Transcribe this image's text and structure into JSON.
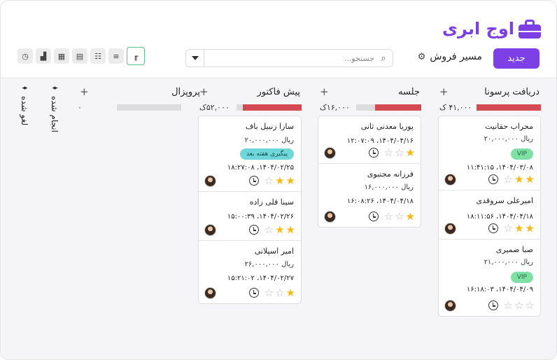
{
  "brand": {
    "logo_text": "اوج ابری",
    "accent": "#7d40e6"
  },
  "toolbar": {
    "new_button": "جدید",
    "pipeline_label": "مسیر فروش",
    "search_placeholder": "جستجو...",
    "view_icons": [
      "kanban-icon",
      "list-icon",
      "table-icon",
      "calendar-icon",
      "grid-icon",
      "chart-icon",
      "history-icon"
    ]
  },
  "columns": [
    {
      "title": "دریافت پرسونا",
      "amount": "۴۱,۰۰۰ ک",
      "progress": 0.7,
      "cards": [
        {
          "name": "محراب حقانیت",
          "amount": "ریال ۲۰,۰۰۰,۰۰۰",
          "badge": "VIP",
          "date": "۱۴۰۴/۰۳/۰۸، ۱۱:۴۱:۱۵",
          "stars": 2
        },
        {
          "name": "امیرعلی سروقدی",
          "amount": "",
          "badge": "",
          "date": "۱۴۰۴/۰۴/۱۸، ۱۸:۱۱:۵۶",
          "stars": 2
        },
        {
          "name": "صبا ضمیری",
          "amount": "ریال ۲۱,۰۰۰,۰۰۰",
          "badge": "VIP",
          "date": "۱۴۰۴/۰۴/۰۹، ۱۶:۱۸:۰۳",
          "stars": 0
        }
      ]
    },
    {
      "title": "جلسه",
      "amount": "۱۶,۰۰۰ک",
      "progress": 0.7,
      "cards": [
        {
          "name": "پوریا معدنی ثانی",
          "amount": "",
          "badge": "",
          "date": "۱۴۰۴/۰۴/۱۶، ۱۲:۰۷:۰۹",
          "stars": 1
        },
        {
          "name": "فرزانه مجتبوی",
          "amount": "ریال ۱۶,۰۰۰,۰۰۰",
          "badge": "",
          "date": "۱۴۰۴/۰۴/۱۸، ۱۶:۰۸:۲۶",
          "stars": 1
        }
      ]
    },
    {
      "title": "پیش فاکتور",
      "amount": "۵۲,۰۰۰ک",
      "progress": 0.85,
      "cards": [
        {
          "name": "سارا زنبیل باف",
          "amount": "ریال ۲۰,۰۰۰,۰۰۰",
          "badge": "پیگیری هفته بعد",
          "date": "۱۴۰۴/۰۲/۲۵، ۱۸:۲۷:۰۸",
          "stars": 2
        },
        {
          "name": "سینا قلی زاده",
          "amount": "",
          "badge": "",
          "date": "۱۴۰۴/۰۲/۲۶، ۱۵:۰۰:۳۹",
          "stars": 2
        },
        {
          "name": "امیر اسپلانی",
          "amount": "ریال ۲۶,۰۰۰,۰۰۰",
          "badge": "",
          "date": "۱۴۰۴/۰۲/۲۷، ۱۵:۲۱:۰۲",
          "stars": 1
        }
      ]
    },
    {
      "title": "پروپزال",
      "amount": "",
      "progress": 0,
      "cards": []
    }
  ],
  "closed_columns": [
    {
      "label": "انجام شده",
      "count": "۰"
    },
    {
      "label": "لغو شده",
      "count": ""
    }
  ]
}
